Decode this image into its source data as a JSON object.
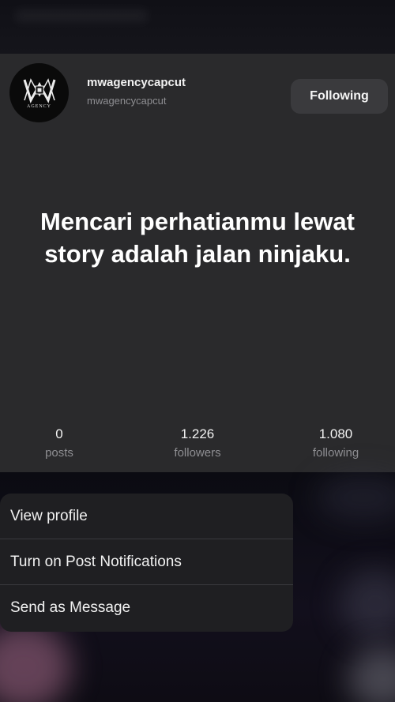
{
  "profile": {
    "avatar_logo_text": "AGENCY",
    "username": "mwagencycapcut",
    "handle": "mwagencycapcut",
    "follow_label": "Following",
    "quote": "Mencari perhatianmu lewat story adalah jalan ninjaku.",
    "stats": [
      {
        "value": "0",
        "label": "posts"
      },
      {
        "value": "1.226",
        "label": "followers"
      },
      {
        "value": "1.080",
        "label": "following"
      }
    ]
  },
  "menu": {
    "items": [
      {
        "label": "View profile"
      },
      {
        "label": "Turn on Post Notifications"
      },
      {
        "label": "Send as Message"
      }
    ]
  },
  "colors": {
    "card_background": "#2a2a2c",
    "button_background": "#3a3a3d",
    "menu_background": "#1f1f22",
    "muted_text": "#8e8e92"
  },
  "icons": {
    "avatar": "mw-agency-logo"
  }
}
